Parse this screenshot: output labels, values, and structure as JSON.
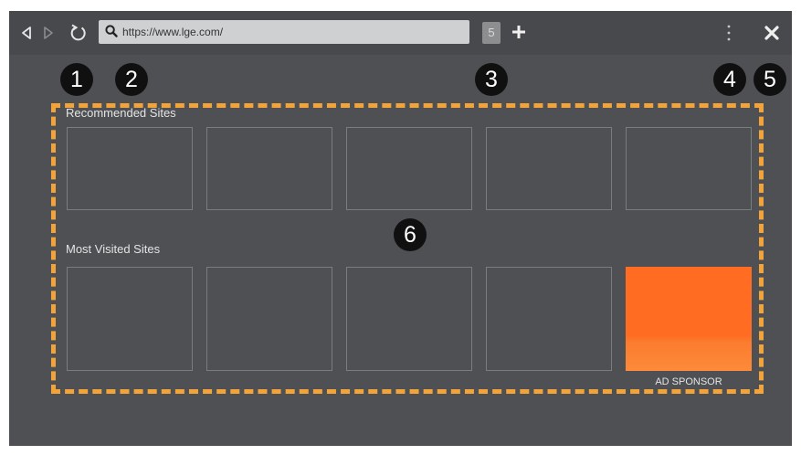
{
  "toolbar": {
    "url": "https://www.lge.com/",
    "tab_count": "5"
  },
  "sections": {
    "recommended_title": "Recommended Sites",
    "most_visited_title": "Most Visited Sites"
  },
  "ad": {
    "label": "AD SPONSOR",
    "color": "#ff6c22"
  },
  "callouts": [
    "1",
    "2",
    "3",
    "4",
    "5",
    "6"
  ],
  "colors": {
    "background": "#4e5053",
    "toolbar": "#48494c",
    "frame_dash": "#f2a43a"
  },
  "icons": [
    "back-icon",
    "forward-icon",
    "refresh-icon",
    "search-icon",
    "plus-icon",
    "more-vertical-icon",
    "close-icon"
  ]
}
